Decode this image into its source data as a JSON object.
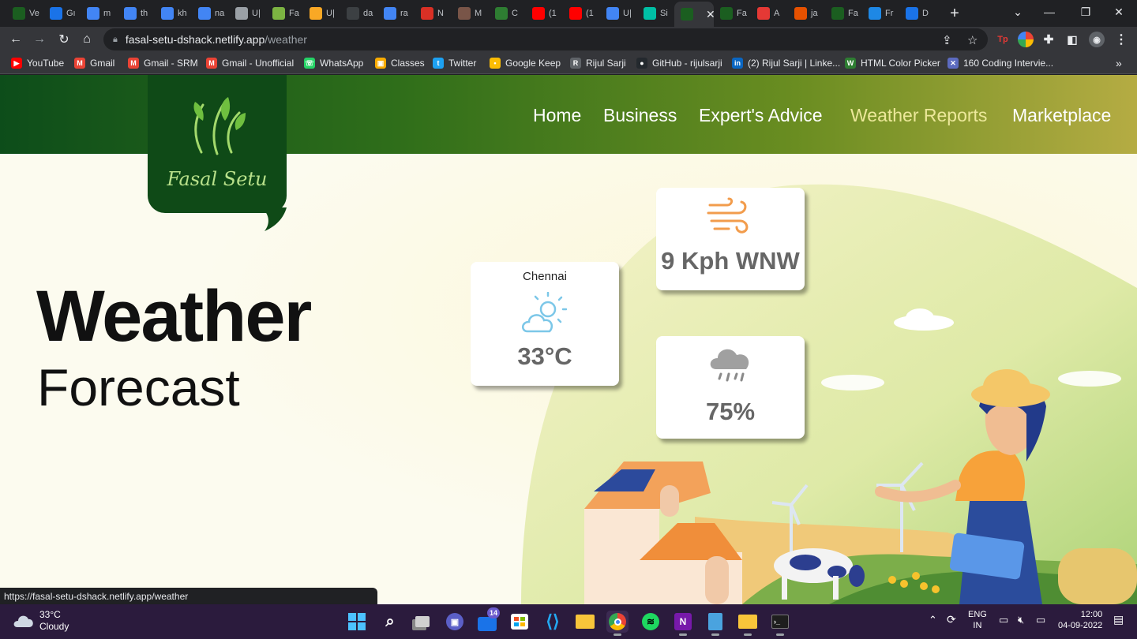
{
  "browser": {
    "tabs": [
      {
        "label": "Ve",
        "color": "#1b5e20"
      },
      {
        "label": "Gı",
        "color": "#1a73e8"
      },
      {
        "label": "m",
        "color": "#4285f4"
      },
      {
        "label": "th",
        "color": "#4285f4"
      },
      {
        "label": "kh",
        "color": "#4285f4"
      },
      {
        "label": "na",
        "color": "#4285f4"
      },
      {
        "label": "U|",
        "color": "#9aa0a6"
      },
      {
        "label": "Fa",
        "color": "#7cb342"
      },
      {
        "label": "U|",
        "color": "#f9a825"
      },
      {
        "label": "da",
        "color": "#3c4043"
      },
      {
        "label": "ra",
        "color": "#4285f4"
      },
      {
        "label": "N",
        "color": "#d93025"
      },
      {
        "label": "M",
        "color": "#795548"
      },
      {
        "label": "C",
        "color": "#2e7d32"
      },
      {
        "label": "(1",
        "color": "#ff0000"
      },
      {
        "label": "(1",
        "color": "#ff0000"
      },
      {
        "label": "U|",
        "color": "#4285f4"
      },
      {
        "label": "Si",
        "color": "#00bfa5"
      },
      {
        "label": "",
        "color": "#1b5e20"
      },
      {
        "label": "Fa",
        "color": "#1b5e20"
      },
      {
        "label": "A",
        "color": "#e53935"
      },
      {
        "label": "ja",
        "color": "#e65100"
      },
      {
        "label": "Fa",
        "color": "#1b5e20"
      },
      {
        "label": "Fr",
        "color": "#1e88e5"
      },
      {
        "label": "D",
        "color": "#1a73e8"
      }
    ],
    "new_tab": "+",
    "url_host": "fasal-setu-dshack.netlify.app",
    "url_path": "/weather",
    "bookmarks": [
      {
        "label": "YouTube",
        "color": "#ff0000",
        "glyph": "▶"
      },
      {
        "label": "Gmail",
        "color": "#ea4335",
        "glyph": "M"
      },
      {
        "label": "Gmail - SRM",
        "color": "#ea4335",
        "glyph": "M"
      },
      {
        "label": "Gmail - Unofficial",
        "color": "#ea4335",
        "glyph": "M"
      },
      {
        "label": "WhatsApp",
        "color": "#25d366",
        "glyph": "☏"
      },
      {
        "label": "Classes",
        "color": "#f9ab00",
        "glyph": "▣"
      },
      {
        "label": "Twitter",
        "color": "#1da1f2",
        "glyph": "t"
      },
      {
        "label": "Google Keep",
        "color": "#fbbc04",
        "glyph": "•"
      },
      {
        "label": "Rijul Sarji",
        "color": "#5f6368",
        "glyph": "R"
      },
      {
        "label": "GitHub - rijulsarji",
        "color": "#24292e",
        "glyph": "●"
      },
      {
        "label": "(2) Rijul Sarji | Linke...",
        "color": "#0a66c2",
        "glyph": "in"
      },
      {
        "label": "HTML Color Picker",
        "color": "#2e7d32",
        "glyph": "W"
      },
      {
        "label": "160 Coding Intervie...",
        "color": "#5c6bc0",
        "glyph": "✕"
      }
    ],
    "more_bookmarks": "»",
    "status_url": "https://fasal-setu-dshack.netlify.app/weather"
  },
  "site": {
    "brand": "Fasal Setu",
    "nav": [
      "Home",
      "Business",
      "Expert's Advice",
      "Weather Reports",
      "Marketplace"
    ],
    "active_nav": "Weather Reports",
    "hero_title": "Weather",
    "hero_subtitle": "Forecast",
    "city": "Chennai",
    "temperature": "33°C",
    "wind": "9 Kph WNW",
    "humidity": "75%",
    "chat_icon": "chat-icon"
  },
  "taskbar": {
    "weather_temp": "33°C",
    "weather_desc": "Cloudy",
    "mail_badge": "14",
    "lang_top": "ENG",
    "lang_bottom": "IN",
    "time": "12:00",
    "date": "04-09-2022"
  },
  "colors": {
    "navbar_start": "#0d4d1a",
    "navbar_end": "#b5ac43",
    "active_nav": "#ece89a",
    "logo_bg": "#0f4a17",
    "taskbar": "#2b1b3d"
  }
}
